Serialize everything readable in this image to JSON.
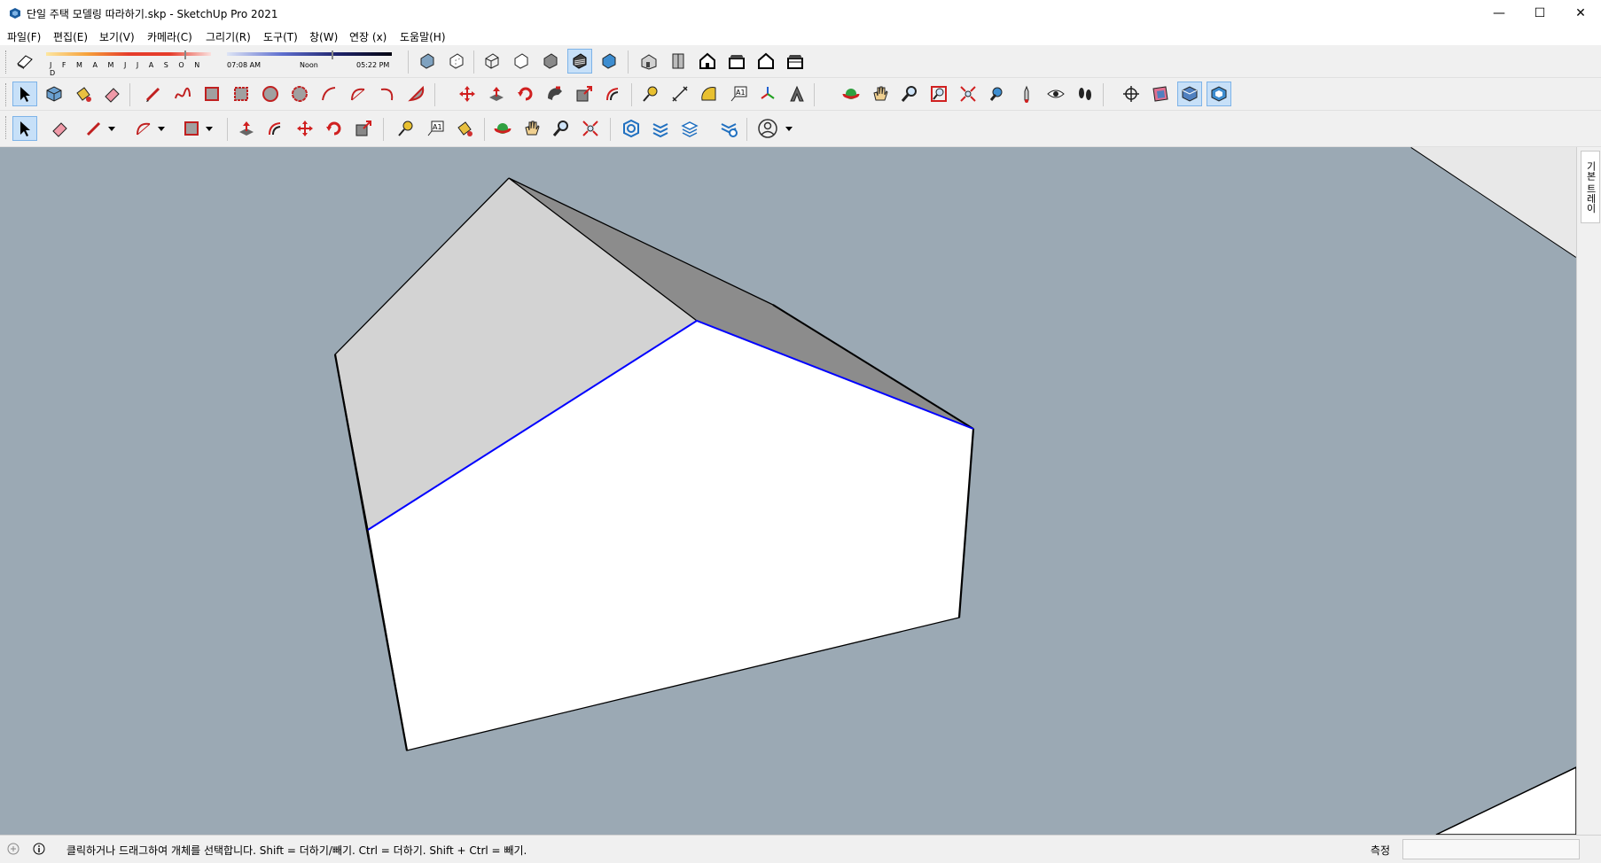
{
  "window": {
    "title": "단일 주택 모델링 따라하기.skp - SketchUp Pro 2021",
    "minimize": "—",
    "maximize": "☐",
    "close": "✕"
  },
  "menu": [
    {
      "label": "파일(F)"
    },
    {
      "label": "편집(E)"
    },
    {
      "label": "보기(V)"
    },
    {
      "label": "카메라(C)"
    },
    {
      "label": "그리기(R)"
    },
    {
      "label": "도구(T)"
    },
    {
      "label": "창(W)"
    },
    {
      "label": "연장 (x)"
    },
    {
      "label": "도움말(H)"
    }
  ],
  "shadows": {
    "months": "J F M A M J J A S O N D",
    "time_start": "07:08 AM",
    "time_mid": "Noon",
    "time_end": "05:22 PM"
  },
  "toolbar1": {
    "icons": [
      "shadow-toggle-icon",
      "xray-icon",
      "back-edges-icon",
      "wireframe-icon",
      "hidden-line-icon",
      "shaded-icon",
      "shaded-textures-icon",
      "monochrome-icon",
      "iso-view-icon",
      "top-view-icon",
      "front-view-icon",
      "right-view-icon",
      "back-view-icon",
      "left-view-icon"
    ]
  },
  "toolbar2": {
    "icons": [
      "select-icon",
      "component-icon",
      "paint-bucket-icon",
      "eraser-icon",
      "line-icon",
      "freehand-icon",
      "rectangle-icon",
      "rotated-rectangle-icon",
      "circle-icon",
      "polygon-icon",
      "arc-icon",
      "two-point-arc-icon",
      "three-point-arc-icon",
      "pie-icon",
      "move-icon",
      "push-pull-icon",
      "rotate-icon",
      "follow-me-icon",
      "scale-icon",
      "offset-icon",
      "tape-measure-icon",
      "dimension-icon",
      "protractor-icon",
      "text-icon",
      "axes-icon",
      "3d-text-icon",
      "orbit-icon",
      "pan-icon",
      "zoom-icon",
      "zoom-window-icon",
      "zoom-extents-icon",
      "previous-view-icon",
      "position-camera-icon",
      "look-around-icon",
      "walk-icon",
      "section-plane-icon",
      "display-section-planes-icon",
      "display-section-cuts-icon",
      "display-section-fill-icon"
    ]
  },
  "toolbar3": {
    "icons": [
      "select-icon",
      "eraser-icon",
      "line-icon",
      "arc-icon",
      "shapes-icon",
      "push-pull-icon",
      "offset-icon",
      "move-icon",
      "rotate-icon",
      "scale-icon",
      "tape-measure-icon",
      "text-icon",
      "paint-bucket-icon",
      "orbit-icon",
      "pan-icon",
      "zoom-icon",
      "zoom-extents-icon",
      "3d-warehouse-icon",
      "extension-warehouse-icon",
      "layout-icon",
      "extension-manager-icon",
      "account-icon"
    ]
  },
  "sidetray": {
    "tab_label": "기본 트레이"
  },
  "status": {
    "message": "클릭하거나 드래그하여 개체를 선택합니다. Shift = 더하기/빼기. Ctrl = 더하기. Shift + Ctrl = 빼기.",
    "measure_label": "측정",
    "measure_value": ""
  },
  "colors": {
    "viewport_bg": "#9ba9b4",
    "selection_edge": "#0000ff",
    "toolbar_bg": "#f0f0f0"
  }
}
